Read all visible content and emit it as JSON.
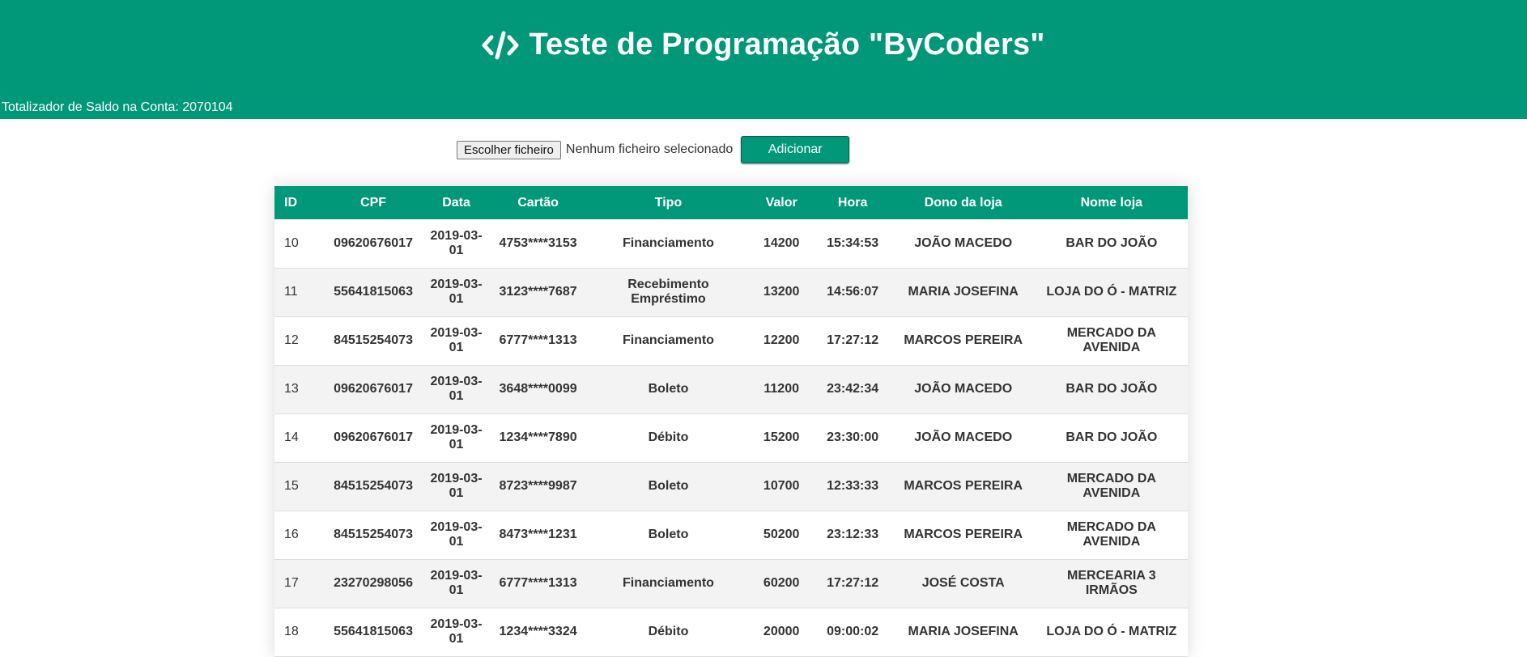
{
  "header": {
    "title": "Teste de Programação \"ByCoders\"",
    "icon": "code-icon",
    "balance_text": "Totalizador de Saldo na Conta: 2070104"
  },
  "upload": {
    "choose_label": "Escolher ficheiro",
    "status": "Nenhum ficheiro selecionado",
    "add_label": "Adicionar"
  },
  "table": {
    "columns": [
      "ID",
      "CPF",
      "Data",
      "Cartão",
      "Tipo",
      "Valor",
      "Hora",
      "Dono da loja",
      "Nome loja"
    ],
    "rows": [
      [
        "10",
        "09620676017",
        "2019-03-01",
        "4753****3153",
        "Financiamento",
        "14200",
        "15:34:53",
        "JOÃO MACEDO",
        "BAR DO JOÃO"
      ],
      [
        "11",
        "55641815063",
        "2019-03-01",
        "3123****7687",
        "Recebimento Empréstimo",
        "13200",
        "14:56:07",
        "MARIA JOSEFINA",
        "LOJA DO Ó - MATRIZ"
      ],
      [
        "12",
        "84515254073",
        "2019-03-01",
        "6777****1313",
        "Financiamento",
        "12200",
        "17:27:12",
        "MARCOS PEREIRA",
        "MERCADO DA AVENIDA"
      ],
      [
        "13",
        "09620676017",
        "2019-03-01",
        "3648****0099",
        "Boleto",
        "11200",
        "23:42:34",
        "JOÃO MACEDO",
        "BAR DO JOÃO"
      ],
      [
        "14",
        "09620676017",
        "2019-03-01",
        "1234****7890",
        "Débito",
        "15200",
        "23:30:00",
        "JOÃO MACEDO",
        "BAR DO JOÃO"
      ],
      [
        "15",
        "84515254073",
        "2019-03-01",
        "8723****9987",
        "Boleto",
        "10700",
        "12:33:33",
        "MARCOS PEREIRA",
        "MERCADO DA AVENIDA"
      ],
      [
        "16",
        "84515254073",
        "2019-03-01",
        "8473****1231",
        "Boleto",
        "50200",
        "23:12:33",
        "MARCOS PEREIRA",
        "MERCADO DA AVENIDA"
      ],
      [
        "17",
        "23270298056",
        "2019-03-01",
        "6777****1313",
        "Financiamento",
        "60200",
        "17:27:12",
        "JOSÉ COSTA",
        "MERCEARIA 3 IRMÃOS"
      ],
      [
        "18",
        "55641815063",
        "2019-03-01",
        "1234****3324",
        "Débito",
        "20000",
        "09:00:02",
        "MARIA JOSEFINA",
        "LOJA DO Ó - MATRIZ"
      ]
    ]
  },
  "colors": {
    "accent": "#009879",
    "row_alt": "#f3f3f3"
  }
}
